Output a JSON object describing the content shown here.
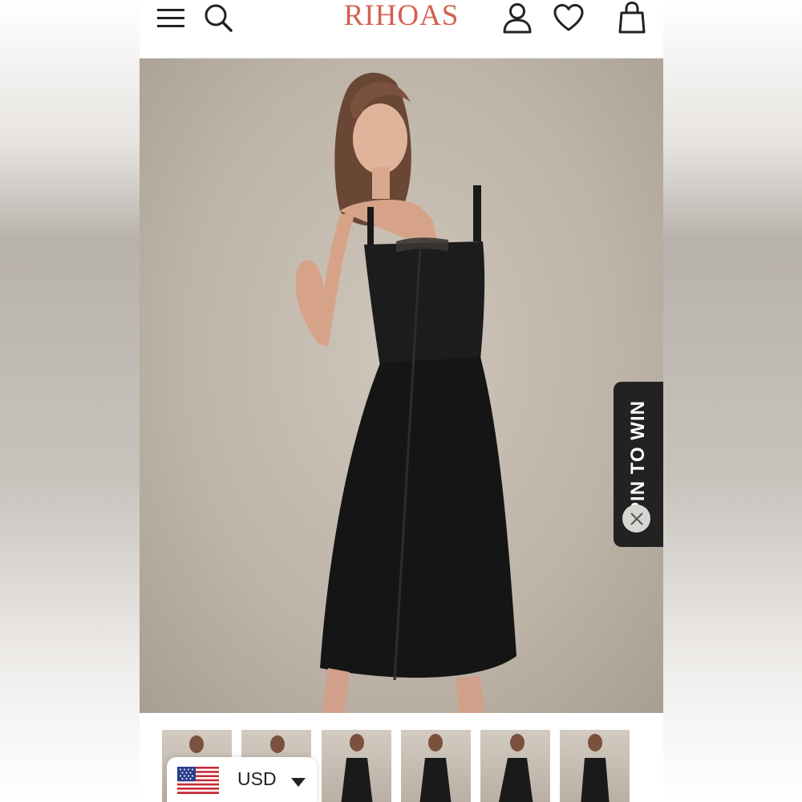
{
  "header": {
    "brand": "RIHOAS",
    "brand_color": "#d4604f",
    "icons": [
      "menu-icon",
      "search-icon",
      "account-icon",
      "wishlist-icon",
      "bag-icon"
    ]
  },
  "hero": {
    "image": "model-in-black-sleeveless-button-front-midi-dress"
  },
  "promo": {
    "spin_label": "SPIN TO WIN",
    "close_icon": "close-icon"
  },
  "gallery": {
    "thumbnails": [
      "thumb-1",
      "thumb-2",
      "thumb-3",
      "thumb-4",
      "thumb-5",
      "thumb-6"
    ]
  },
  "currency": {
    "code": "USD",
    "flag": "us-flag-icon",
    "caret": "caret-down-icon"
  }
}
